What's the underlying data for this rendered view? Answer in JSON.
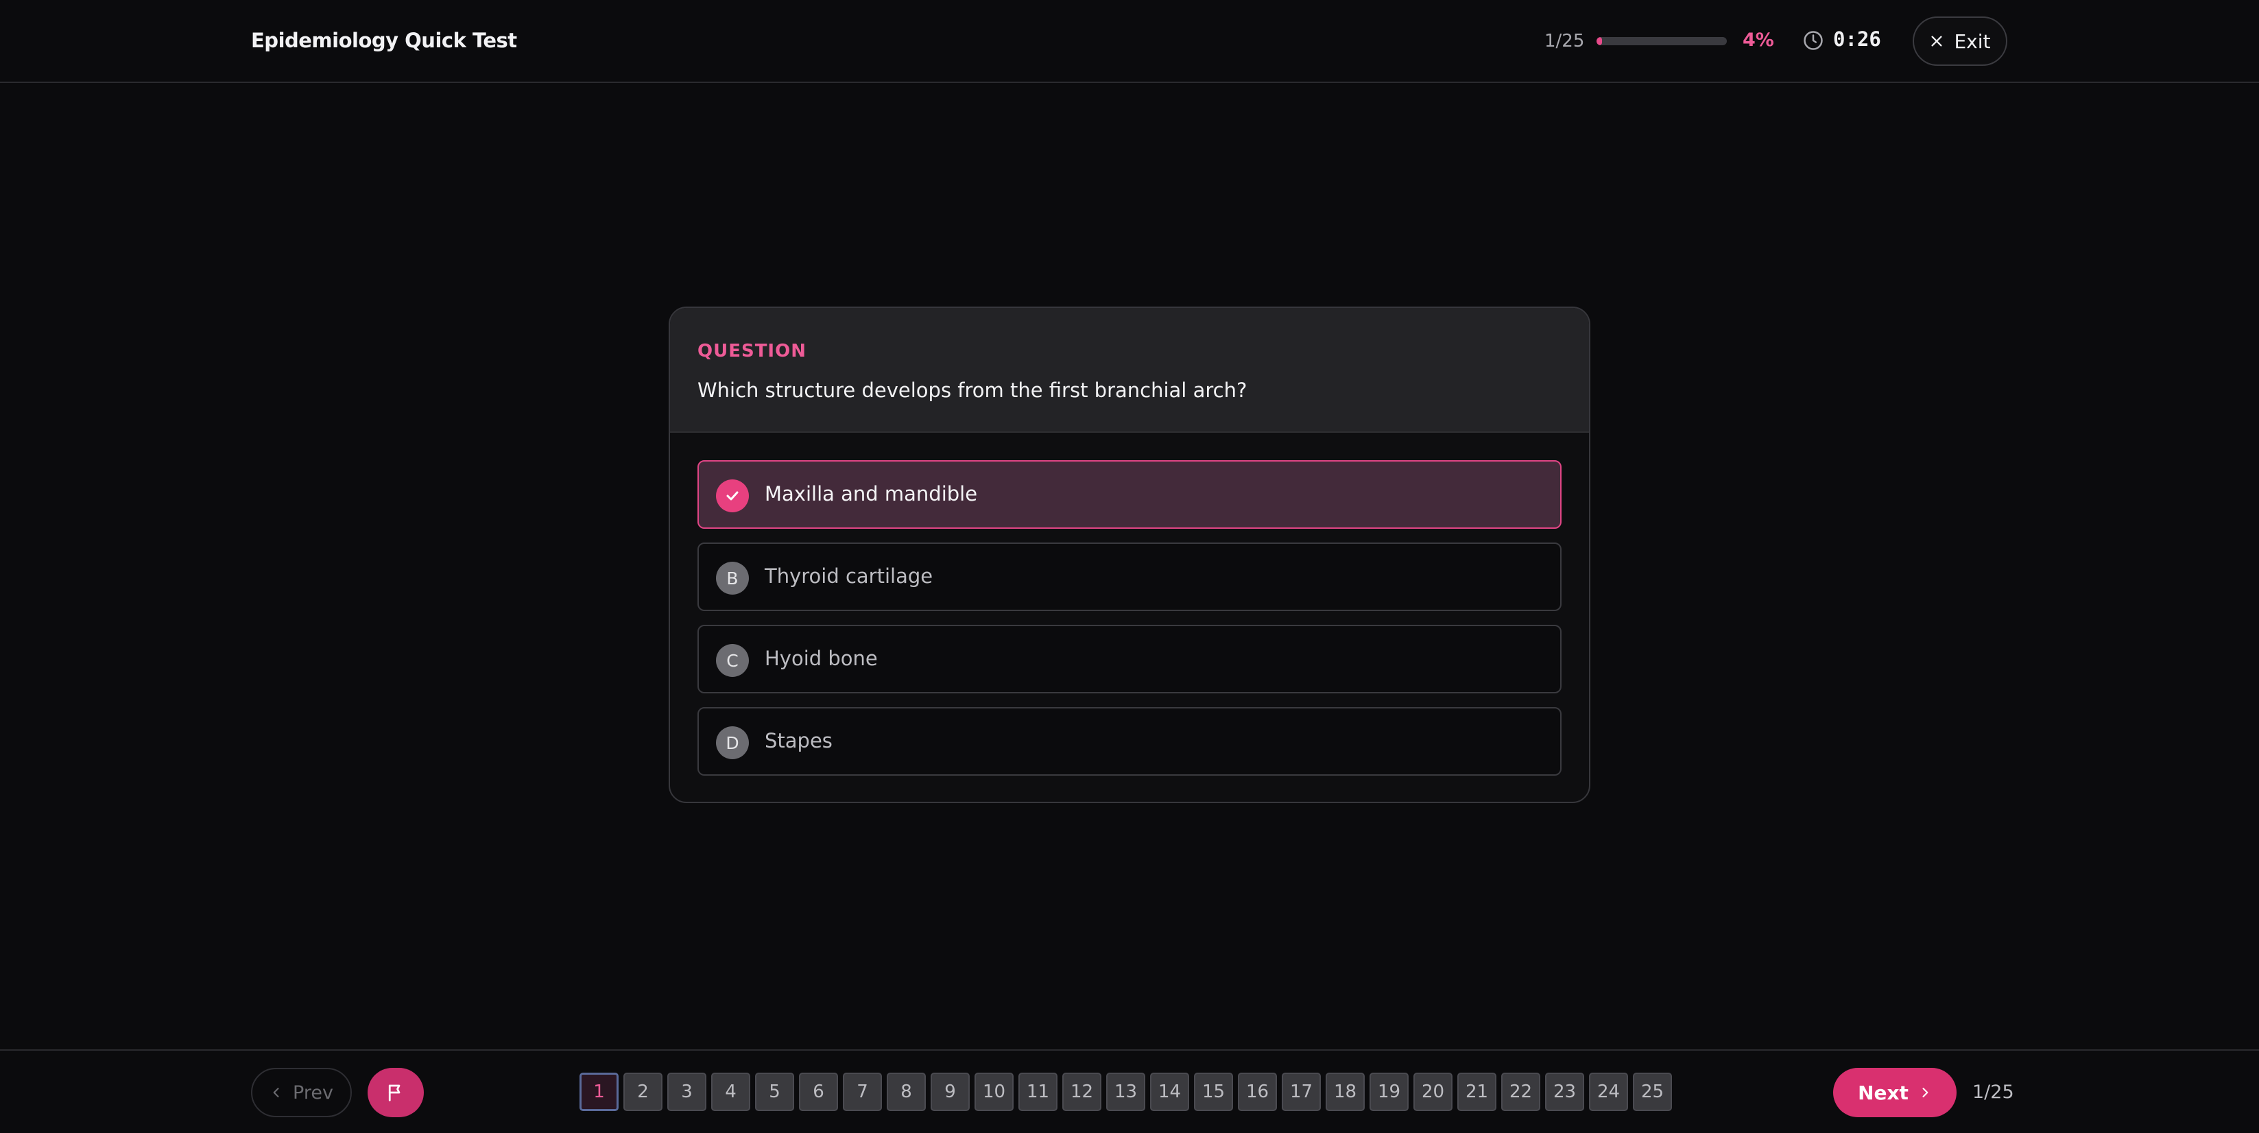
{
  "header": {
    "title": "Epidemiology Quick Test",
    "progress_text": "1/25",
    "progress_fraction": 0.04,
    "progress_percent": "4%",
    "timer": "0:26",
    "exit_label": "Exit"
  },
  "question": {
    "label": "QUESTION",
    "text": "Which structure develops from the first branchial arch?",
    "options": [
      {
        "letter": "A",
        "text": "Maxilla and mandible",
        "selected": true
      },
      {
        "letter": "B",
        "text": "Thyroid cartilage",
        "selected": false
      },
      {
        "letter": "C",
        "text": "Hyoid bone",
        "selected": false
      },
      {
        "letter": "D",
        "text": "Stapes",
        "selected": false
      }
    ]
  },
  "footer": {
    "prev_label": "Prev",
    "next_label": "Next",
    "count_text": "1/25",
    "current_page": 1,
    "pages": [
      "1",
      "2",
      "3",
      "4",
      "5",
      "6",
      "7",
      "8",
      "9",
      "10",
      "11",
      "12",
      "13",
      "14",
      "15",
      "16",
      "17",
      "18",
      "19",
      "20",
      "21",
      "22",
      "23",
      "24",
      "25"
    ]
  },
  "colors": {
    "accent": "#e8407f",
    "background": "#0b0b0d",
    "card": "#232326"
  }
}
